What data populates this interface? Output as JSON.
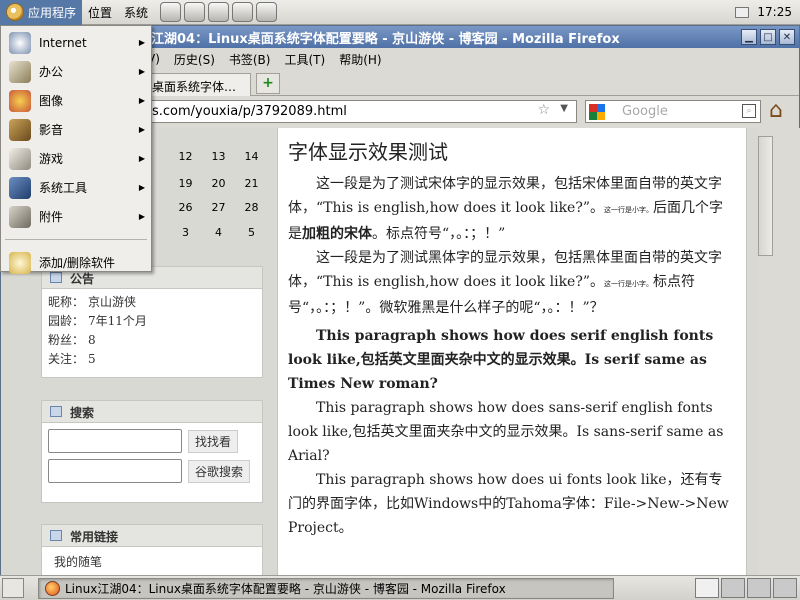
{
  "panel": {
    "menus": [
      "应用程序",
      "位置",
      "系统"
    ],
    "clock": "17:25"
  },
  "app_menu": {
    "items": [
      {
        "label": "Internet",
        "submenu": true
      },
      {
        "label": "办公",
        "submenu": true
      },
      {
        "label": "图像",
        "submenu": true
      },
      {
        "label": "影音",
        "submenu": true
      },
      {
        "label": "游戏",
        "submenu": true
      },
      {
        "label": "系统工具",
        "submenu": true
      },
      {
        "label": "附件",
        "submenu": true
      }
    ],
    "extra": "添加/删除软件"
  },
  "window": {
    "title": "江湖04：Linux桌面系统字体配置要略 - 京山游侠 - 博客园 - Mozilla Firefox",
    "menubar": [
      "V)",
      "历史(S)",
      "书签(B)",
      "工具(T)",
      "帮助(H)"
    ],
    "tab_label": "桌面系统字体…",
    "tab_add": "+",
    "url": "s.com/youxia/p/3792089.html",
    "search_placeholder": "Google"
  },
  "calendar": {
    "rows": [
      [
        "12",
        "13",
        "14"
      ],
      [
        "19",
        "20",
        "21"
      ],
      [
        "26",
        "27",
        "28"
      ],
      [
        "3",
        "4",
        "5"
      ]
    ]
  },
  "sidebar": {
    "notice": {
      "title": "公告",
      "rows": [
        {
          "key": "昵称：",
          "value": "京山游侠"
        },
        {
          "key": "园龄：",
          "value": "7年11个月"
        },
        {
          "key": "粉丝：",
          "value": "8"
        },
        {
          "key": "关注：",
          "value": "5"
        }
      ]
    },
    "search": {
      "title": "搜索",
      "btn1": "找找看",
      "btn2": "谷歌搜索"
    },
    "links": {
      "title": "常用链接",
      "first": "我的随笔"
    }
  },
  "post": {
    "heading": "字体显示效果测试",
    "p1_a": "这一段是为了测试宋体字的显示效果，包括宋体里面自带的英文字体，“This is english,how does it look like?”。",
    "p1_small": "这一行是小字。",
    "p1_b": "后面几个字是",
    "p1_bold": "加粗的宋体",
    "p1_c": "。标点符号“，。：；！”",
    "p2_a": "这一段是为了测试黑体字的显示效果，包括黑体里面自带的英文字体，“This is english,how does it look like?”。",
    "p2_small": "这一行是小字。",
    "p2_b": "标点符号“，。：；！”。微软雅黑是什么样子的呢“，。：！”？",
    "p3": "This paragraph shows how does serif english fonts look like,包括英文里面夹杂中文的显示效果。Is serif same as Times New roman?",
    "p4": "This paragraph shows how does sans-serif english fonts look like,包括英文里面夹杂中文的显示效果。Is sans-serif same as Arial?",
    "p5": "This paragraph shows how does ui fonts look like，还有专门的界面字体，比如Windows中的Tahoma字体：File->New->New Project。"
  },
  "taskbar": {
    "task_label": "Linux江湖04：Linux桌面系统字体配置要略 - 京山游侠 - 博客园 - Mozilla Firefox"
  }
}
